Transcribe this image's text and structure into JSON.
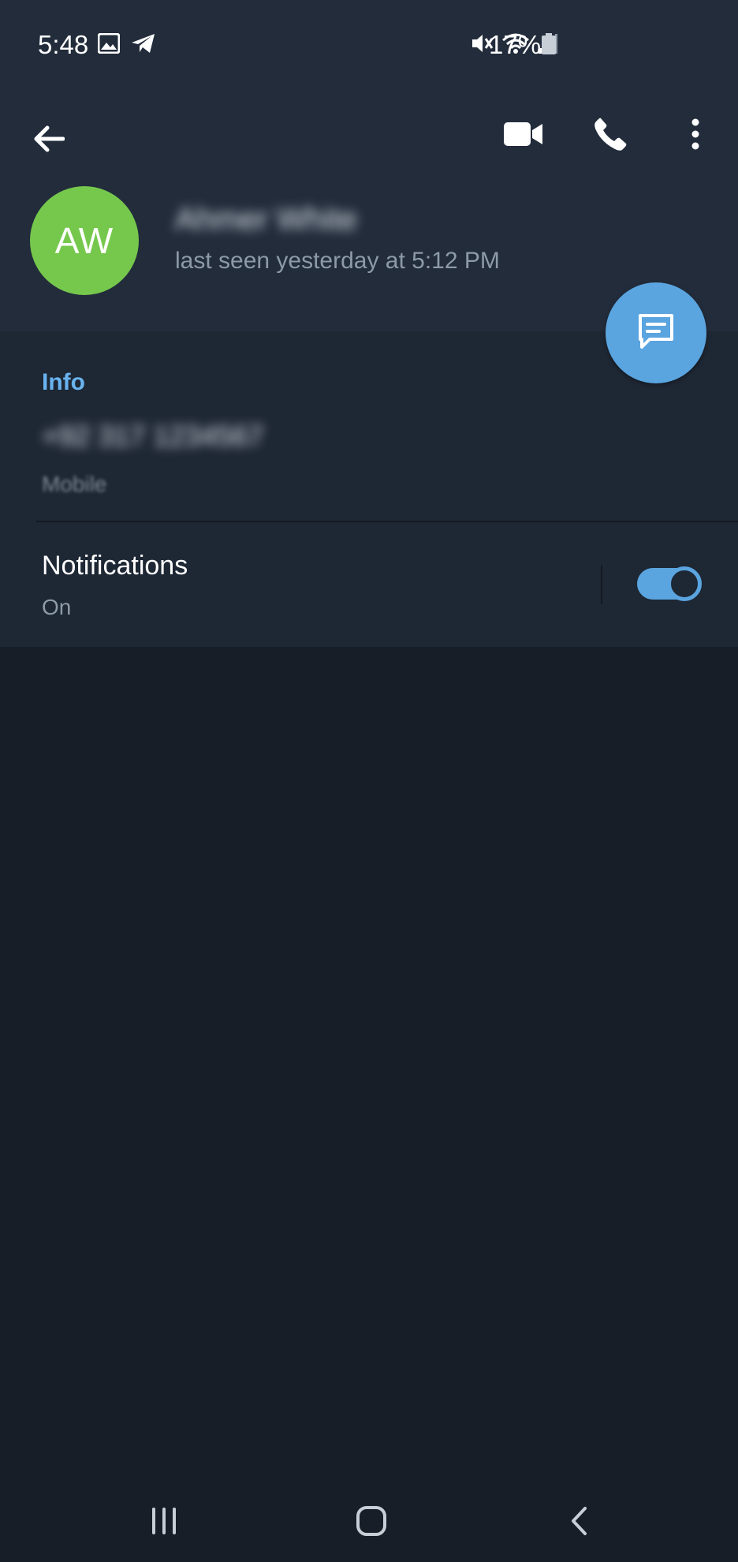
{
  "status_bar": {
    "time": "5:48",
    "battery": "17%",
    "icons": [
      "image-icon",
      "telegram-icon",
      "mute-icon",
      "wifi-icon",
      "signal-icon",
      "battery-icon"
    ]
  },
  "header": {
    "icons": [
      "back-arrow-icon",
      "video-call-icon",
      "phone-icon",
      "more-vert-icon"
    ]
  },
  "contact": {
    "initials": "AW",
    "name": "Ahmer White",
    "last_seen": "last seen yesterday at 5:12 PM",
    "avatar_color": "#76c84d"
  },
  "fab": {
    "icon": "message-icon",
    "color": "#5aa5e0"
  },
  "info": {
    "title": "Info",
    "phone": "+92 317 1234567",
    "phone_label": "Mobile"
  },
  "notifications": {
    "title": "Notifications",
    "status": "On",
    "enabled": true
  },
  "nav_bar": {
    "icons": [
      "recents-icon",
      "home-icon",
      "back-icon"
    ]
  },
  "colors": {
    "accent": "#5aa5e0",
    "header_bg": "#222c3b",
    "section_bg": "#1e2734",
    "page_bg": "#171e28",
    "info_title": "#69b4f0"
  }
}
